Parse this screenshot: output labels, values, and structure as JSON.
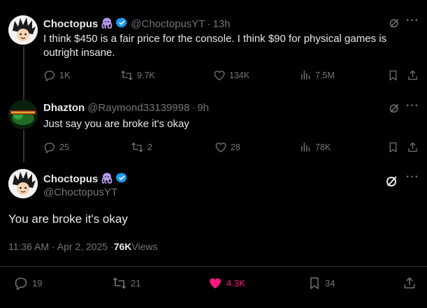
{
  "tweets": [
    {
      "author": "Choctopus",
      "handle": "@ChoctopusYT",
      "time": "13h",
      "text": "I think $450 is a fair price for the console. I think $90 for physical games is outright insane.",
      "replies": "1K",
      "reposts": "9.7K",
      "likes": "134K",
      "views": "7.5M"
    },
    {
      "author": "Dhazton",
      "handle": "@Raymond33139998",
      "time": "9h",
      "text": "Just say you are broke it's okay",
      "replies": "25",
      "reposts": "2",
      "likes": "28",
      "views": "78K"
    }
  ],
  "main_tweet": {
    "author": "Choctopus",
    "handle": "@ChoctopusYT",
    "text": "You are broke it's okay",
    "time": "11:36 AM · Apr 2, 2025 · ",
    "views": "76K",
    "views_label": " Views",
    "replies": "19",
    "reposts": "21",
    "likes": "4.3K",
    "bookmarks": "34"
  },
  "separator": "·",
  "more_label": "···",
  "colors": {
    "background": "#000000",
    "muted": "#71767b",
    "verified": "#1d9bf0",
    "like_active": "#f91880",
    "emoji_octopus": "#b79be8"
  },
  "icons": {
    "reply": "reply-icon",
    "repost": "repost-icon",
    "like": "heart-icon",
    "views": "views-icon",
    "bookmark": "bookmark-icon",
    "share": "share-icon",
    "grok": "grok-icon",
    "verified": "verified-badge-icon",
    "octopus": "octopus-emoji-icon"
  }
}
